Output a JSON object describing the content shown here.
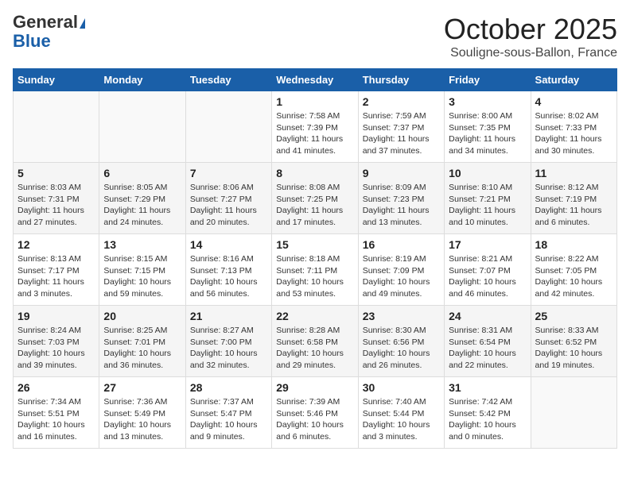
{
  "header": {
    "logo_general": "General",
    "logo_blue": "Blue",
    "month": "October 2025",
    "location": "Souligne-sous-Ballon, France"
  },
  "days_of_week": [
    "Sunday",
    "Monday",
    "Tuesday",
    "Wednesday",
    "Thursday",
    "Friday",
    "Saturday"
  ],
  "weeks": [
    [
      {
        "day": "",
        "info": ""
      },
      {
        "day": "",
        "info": ""
      },
      {
        "day": "",
        "info": ""
      },
      {
        "day": "1",
        "info": "Sunrise: 7:58 AM\nSunset: 7:39 PM\nDaylight: 11 hours\nand 41 minutes."
      },
      {
        "day": "2",
        "info": "Sunrise: 7:59 AM\nSunset: 7:37 PM\nDaylight: 11 hours\nand 37 minutes."
      },
      {
        "day": "3",
        "info": "Sunrise: 8:00 AM\nSunset: 7:35 PM\nDaylight: 11 hours\nand 34 minutes."
      },
      {
        "day": "4",
        "info": "Sunrise: 8:02 AM\nSunset: 7:33 PM\nDaylight: 11 hours\nand 30 minutes."
      }
    ],
    [
      {
        "day": "5",
        "info": "Sunrise: 8:03 AM\nSunset: 7:31 PM\nDaylight: 11 hours\nand 27 minutes."
      },
      {
        "day": "6",
        "info": "Sunrise: 8:05 AM\nSunset: 7:29 PM\nDaylight: 11 hours\nand 24 minutes."
      },
      {
        "day": "7",
        "info": "Sunrise: 8:06 AM\nSunset: 7:27 PM\nDaylight: 11 hours\nand 20 minutes."
      },
      {
        "day": "8",
        "info": "Sunrise: 8:08 AM\nSunset: 7:25 PM\nDaylight: 11 hours\nand 17 minutes."
      },
      {
        "day": "9",
        "info": "Sunrise: 8:09 AM\nSunset: 7:23 PM\nDaylight: 11 hours\nand 13 minutes."
      },
      {
        "day": "10",
        "info": "Sunrise: 8:10 AM\nSunset: 7:21 PM\nDaylight: 11 hours\nand 10 minutes."
      },
      {
        "day": "11",
        "info": "Sunrise: 8:12 AM\nSunset: 7:19 PM\nDaylight: 11 hours\nand 6 minutes."
      }
    ],
    [
      {
        "day": "12",
        "info": "Sunrise: 8:13 AM\nSunset: 7:17 PM\nDaylight: 11 hours\nand 3 minutes."
      },
      {
        "day": "13",
        "info": "Sunrise: 8:15 AM\nSunset: 7:15 PM\nDaylight: 10 hours\nand 59 minutes."
      },
      {
        "day": "14",
        "info": "Sunrise: 8:16 AM\nSunset: 7:13 PM\nDaylight: 10 hours\nand 56 minutes."
      },
      {
        "day": "15",
        "info": "Sunrise: 8:18 AM\nSunset: 7:11 PM\nDaylight: 10 hours\nand 53 minutes."
      },
      {
        "day": "16",
        "info": "Sunrise: 8:19 AM\nSunset: 7:09 PM\nDaylight: 10 hours\nand 49 minutes."
      },
      {
        "day": "17",
        "info": "Sunrise: 8:21 AM\nSunset: 7:07 PM\nDaylight: 10 hours\nand 46 minutes."
      },
      {
        "day": "18",
        "info": "Sunrise: 8:22 AM\nSunset: 7:05 PM\nDaylight: 10 hours\nand 42 minutes."
      }
    ],
    [
      {
        "day": "19",
        "info": "Sunrise: 8:24 AM\nSunset: 7:03 PM\nDaylight: 10 hours\nand 39 minutes."
      },
      {
        "day": "20",
        "info": "Sunrise: 8:25 AM\nSunset: 7:01 PM\nDaylight: 10 hours\nand 36 minutes."
      },
      {
        "day": "21",
        "info": "Sunrise: 8:27 AM\nSunset: 7:00 PM\nDaylight: 10 hours\nand 32 minutes."
      },
      {
        "day": "22",
        "info": "Sunrise: 8:28 AM\nSunset: 6:58 PM\nDaylight: 10 hours\nand 29 minutes."
      },
      {
        "day": "23",
        "info": "Sunrise: 8:30 AM\nSunset: 6:56 PM\nDaylight: 10 hours\nand 26 minutes."
      },
      {
        "day": "24",
        "info": "Sunrise: 8:31 AM\nSunset: 6:54 PM\nDaylight: 10 hours\nand 22 minutes."
      },
      {
        "day": "25",
        "info": "Sunrise: 8:33 AM\nSunset: 6:52 PM\nDaylight: 10 hours\nand 19 minutes."
      }
    ],
    [
      {
        "day": "26",
        "info": "Sunrise: 7:34 AM\nSunset: 5:51 PM\nDaylight: 10 hours\nand 16 minutes."
      },
      {
        "day": "27",
        "info": "Sunrise: 7:36 AM\nSunset: 5:49 PM\nDaylight: 10 hours\nand 13 minutes."
      },
      {
        "day": "28",
        "info": "Sunrise: 7:37 AM\nSunset: 5:47 PM\nDaylight: 10 hours\nand 9 minutes."
      },
      {
        "day": "29",
        "info": "Sunrise: 7:39 AM\nSunset: 5:46 PM\nDaylight: 10 hours\nand 6 minutes."
      },
      {
        "day": "30",
        "info": "Sunrise: 7:40 AM\nSunset: 5:44 PM\nDaylight: 10 hours\nand 3 minutes."
      },
      {
        "day": "31",
        "info": "Sunrise: 7:42 AM\nSunset: 5:42 PM\nDaylight: 10 hours\nand 0 minutes."
      },
      {
        "day": "",
        "info": ""
      }
    ]
  ]
}
